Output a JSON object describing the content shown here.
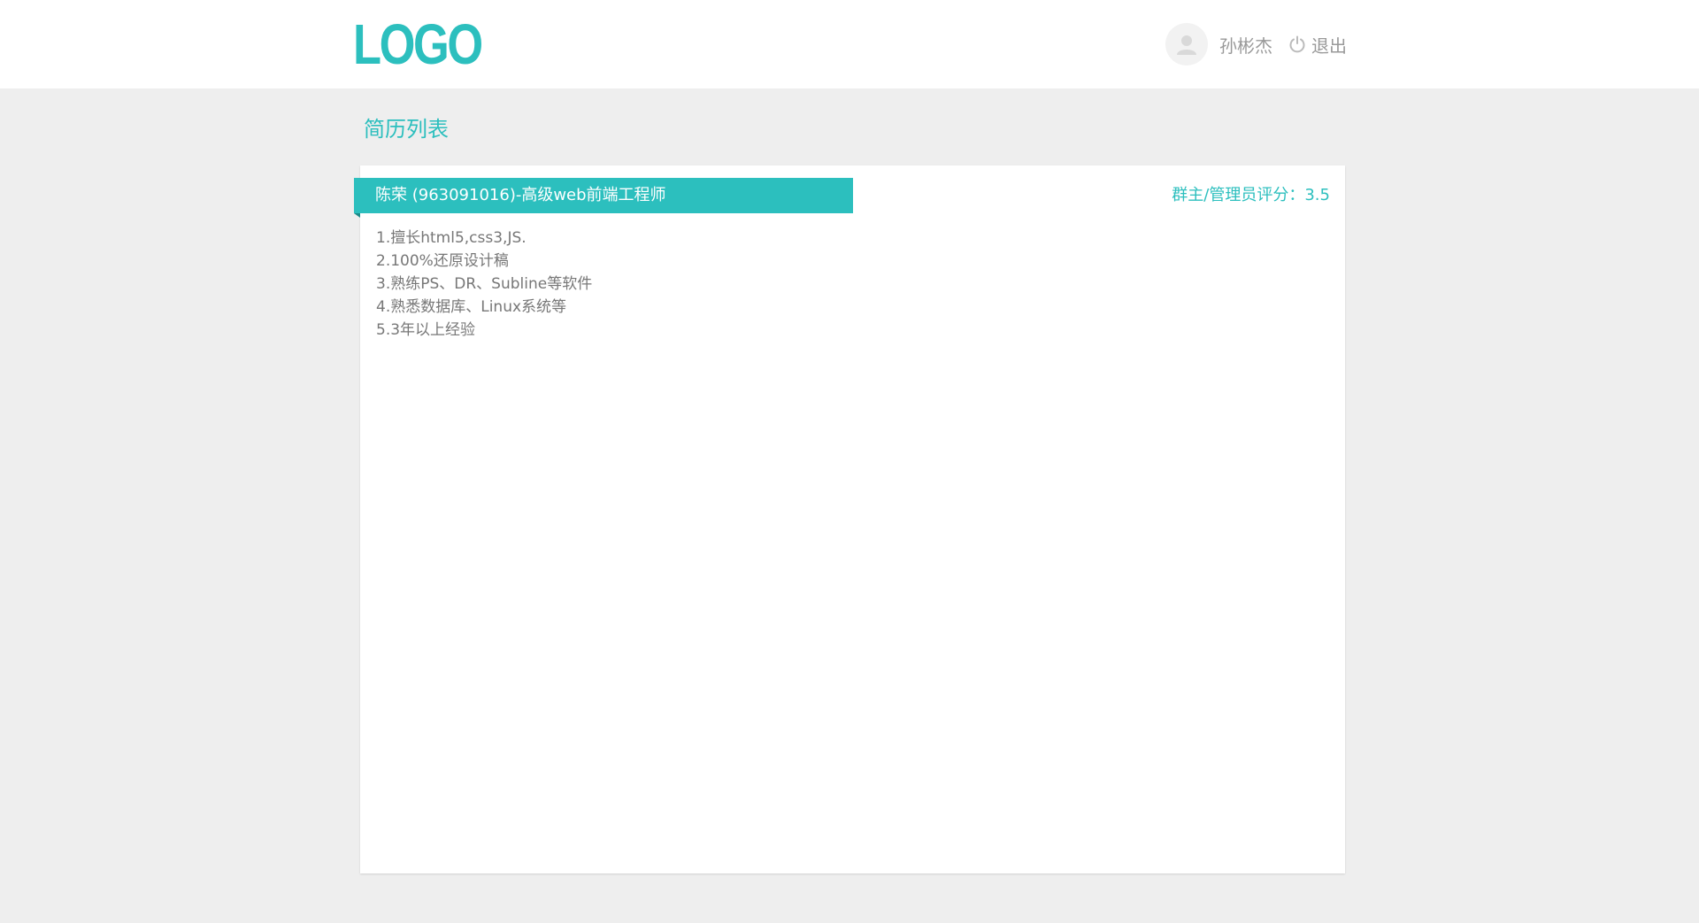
{
  "header": {
    "logo_text": "LOGO",
    "user": {
      "name": "孙彬杰",
      "avatar_icon": "user-avatar-icon"
    },
    "logout": {
      "label": "退出",
      "icon": "power-icon"
    }
  },
  "page": {
    "title": "简历列表"
  },
  "resume": {
    "title": "陈荣 (963091016)-高级web前端工程师",
    "score_label": "群主/管理员评分：",
    "score_value": "3.5",
    "skills": [
      "1.擅长html5,css3,JS.",
      "2.100%还原设计稿",
      "3.熟练PS、DR、Subline等软件",
      "4.熟悉数据库、Linux系统等",
      "5.3年以上经验"
    ]
  },
  "colors": {
    "accent": "#2cbfbe",
    "background": "#eeeeee",
    "muted_text": "#999999"
  }
}
